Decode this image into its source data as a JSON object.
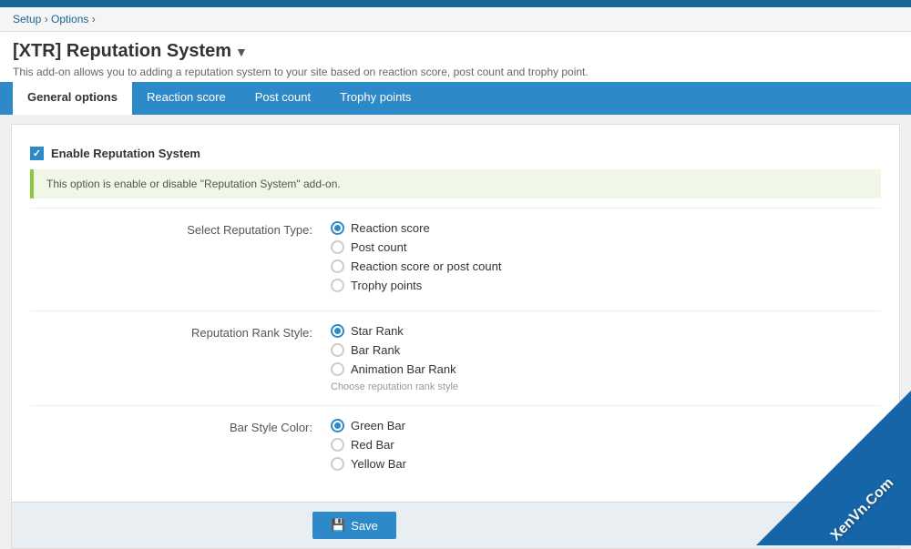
{
  "topbar": {},
  "breadcrumb": {
    "items": [
      {
        "label": "Setup",
        "href": "#"
      },
      {
        "label": "Options",
        "href": "#",
        "active": true
      }
    ],
    "separator": "›"
  },
  "page": {
    "title": "[XTR] Reputation System",
    "title_arrow": "▼",
    "description": "This add-on allows you to adding a reputation system to your site based on reaction score, post count and trophy point."
  },
  "tabs": [
    {
      "label": "General options",
      "active": true
    },
    {
      "label": "Reaction score",
      "active": false
    },
    {
      "label": "Post count",
      "active": false
    },
    {
      "label": "Trophy points",
      "active": false
    }
  ],
  "form": {
    "enable_checkbox_label": "Enable Reputation System",
    "info_text": "This option is enable or disable \"Reputation System\" add-on.",
    "reputation_type": {
      "label": "Select Reputation Type:",
      "options": [
        {
          "label": "Reaction score",
          "checked": true
        },
        {
          "label": "Post count",
          "checked": false
        },
        {
          "label": "Reaction score or post count",
          "checked": false
        },
        {
          "label": "Trophy points",
          "checked": false
        }
      ]
    },
    "rank_style": {
      "label": "Reputation Rank Style:",
      "options": [
        {
          "label": "Star Rank",
          "checked": true
        },
        {
          "label": "Bar Rank",
          "checked": false
        },
        {
          "label": "Animation Bar Rank",
          "checked": false
        }
      ],
      "hint": "Choose reputation rank style"
    },
    "bar_color": {
      "label": "Bar Style Color:",
      "options": [
        {
          "label": "Green Bar",
          "checked": true
        },
        {
          "label": "Red Bar",
          "checked": false
        },
        {
          "label": "Yellow Bar",
          "checked": false
        }
      ]
    },
    "save_button": "Save"
  },
  "watermark": {
    "text": "XenVn.Com"
  }
}
